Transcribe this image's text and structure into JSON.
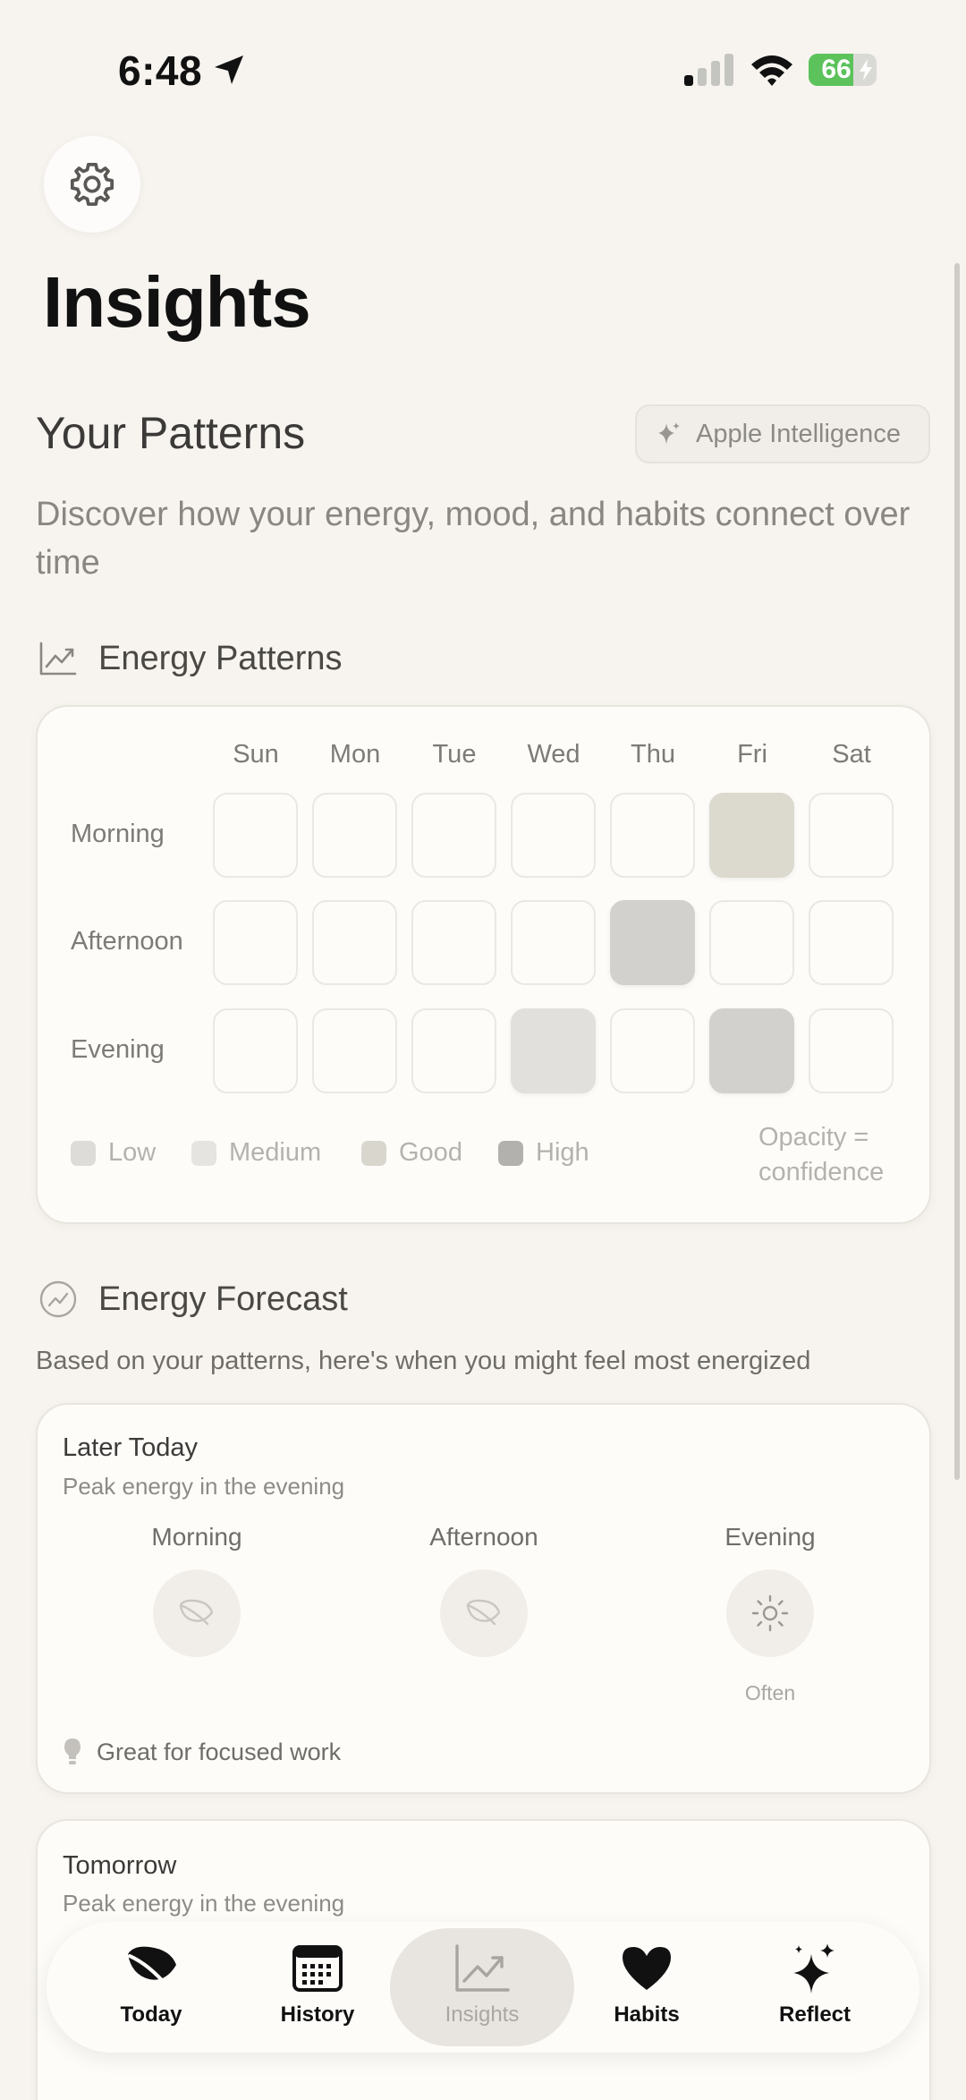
{
  "status": {
    "time": "6:48",
    "battery": "66",
    "battery_level": 0.66
  },
  "page": {
    "title": "Insights"
  },
  "patterns": {
    "title": "Your Patterns",
    "ai_badge": "Apple Intelligence",
    "subtitle": "Discover how your energy, mood, and habits connect over time"
  },
  "energy_patterns": {
    "title": "Energy Patterns",
    "days": [
      "Sun",
      "Mon",
      "Tue",
      "Wed",
      "Thu",
      "Fri",
      "Sat"
    ],
    "periods": [
      "Morning",
      "Afternoon",
      "Evening"
    ],
    "cells": [
      [
        "none",
        "none",
        "none",
        "none",
        "none",
        "good",
        "none"
      ],
      [
        "none",
        "none",
        "none",
        "none",
        "high",
        "none",
        "none"
      ],
      [
        "none",
        "none",
        "none",
        "medium",
        "none",
        "high",
        "none"
      ]
    ],
    "legend": [
      {
        "label": "Low",
        "color": "#dedcd9"
      },
      {
        "label": "Medium",
        "color": "#e6e4e0"
      },
      {
        "label": "Good",
        "color": "#d9d6cd"
      },
      {
        "label": "High",
        "color": "#b3b1ad"
      }
    ],
    "cell_colors": {
      "good": "#dcd9cf",
      "medium": "#e2e0dc",
      "high": "#d2d1ce"
    },
    "legend_note_1": "Opacity =",
    "legend_note_2": "confidence"
  },
  "forecast": {
    "title": "Energy Forecast",
    "description": "Based on your patterns, here's when you might feel most energized",
    "cards": [
      {
        "title": "Later Today",
        "subtitle": "Peak energy in the evening",
        "periods": [
          "Morning",
          "Afternoon",
          "Evening"
        ],
        "evening_frequency": "Often",
        "tip": "Great for focused work"
      },
      {
        "title": "Tomorrow",
        "subtitle": "Peak energy in the evening"
      }
    ]
  },
  "tabs": [
    {
      "label": "Today",
      "icon": "leaf-icon"
    },
    {
      "label": "History",
      "icon": "calendar-icon"
    },
    {
      "label": "Insights",
      "icon": "chart-icon"
    },
    {
      "label": "Habits",
      "icon": "heart-icon"
    },
    {
      "label": "Reflect",
      "icon": "sparkles-icon"
    }
  ],
  "colors": {
    "background": "#f7f4ef",
    "card": "#fdfcf9",
    "battery": "#5cc25b"
  }
}
